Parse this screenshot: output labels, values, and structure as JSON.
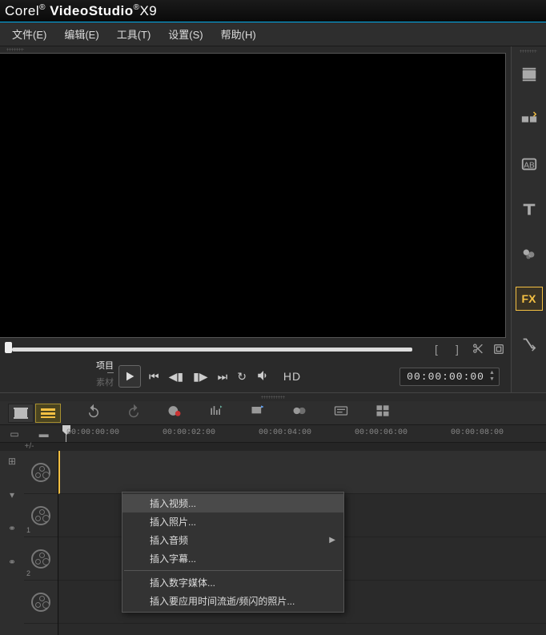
{
  "title": {
    "brand": "Corel",
    "product": "VideoStudio",
    "version": "X9"
  },
  "menu": {
    "file": "文件(E)",
    "edit": "编辑(E)",
    "tools": "工具(T)",
    "settings": "设置(S)",
    "help": "帮助(H)"
  },
  "preview": {
    "mode_project": "项目",
    "mode_clip": "素材",
    "hd_label": "HD",
    "timecode": "00:00:00:00"
  },
  "side_icons": {
    "media": "media-library",
    "transitions": "transitions",
    "titles": "AB",
    "text": "text",
    "graphics": "graphics",
    "fx": "FX",
    "path": "motion-path"
  },
  "ruler": {
    "marks": [
      "00:00:00:00",
      "00:00:02:00",
      "00:00:04:00",
      "00:00:06:00",
      "00:00:08:00"
    ],
    "zoom_label": "+/-"
  },
  "tracks": {
    "labels": [
      "1",
      "2"
    ]
  },
  "context_menu": {
    "insert_video": "插入视频...",
    "insert_photo": "插入照片...",
    "insert_audio": "插入音频",
    "insert_subtitle": "插入字幕...",
    "insert_digital_media": "插入数字媒体...",
    "insert_timelapse": "插入要应用时间流逝/频闪的照片..."
  }
}
